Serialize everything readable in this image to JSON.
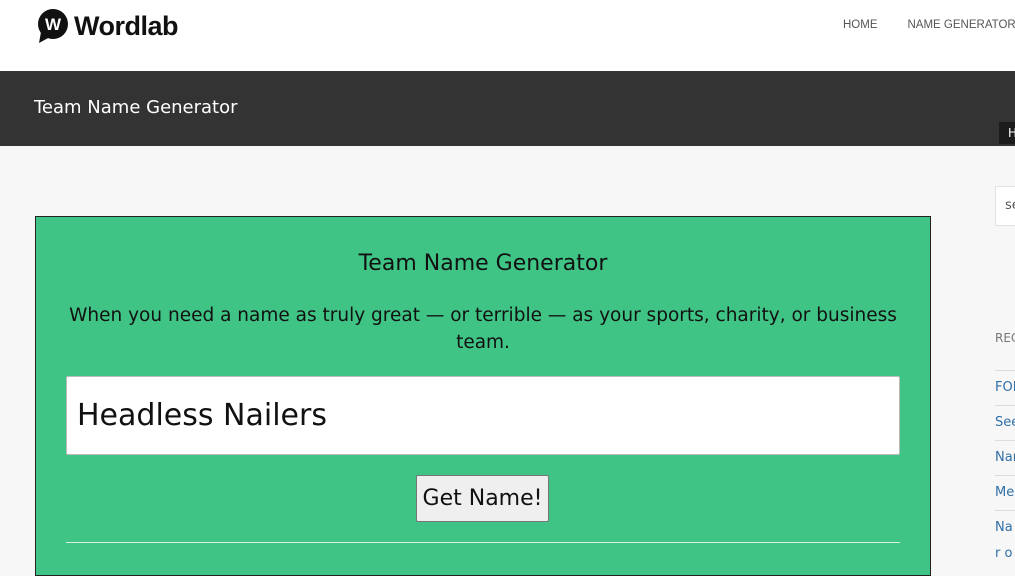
{
  "site": {
    "logo_letter": "W",
    "logo_text": "Wordlab",
    "nav": [
      {
        "label": "HOME"
      },
      {
        "label": "NAME GENERATORS"
      }
    ]
  },
  "title_bar": {
    "title": "Team Name Generator",
    "tab_partial": "H"
  },
  "generator": {
    "title": "Team Name Generator",
    "description": "When you need a name as truly great — or terrible — as your sports, charity, or business team.",
    "output_value": "Headless Nailers",
    "button_label": "Get Name!"
  },
  "sidebar": {
    "search_partial": "se",
    "heading_partial": "REC",
    "items": [
      {
        "label": "FOR"
      },
      {
        "label": "See"
      },
      {
        "label": "Nar"
      },
      {
        "label": "Me"
      },
      {
        "label": "Nar on"
      }
    ]
  },
  "colors": {
    "generator_bg": "#40c486",
    "title_bar_bg": "#333333",
    "link": "#2f6fa7"
  }
}
